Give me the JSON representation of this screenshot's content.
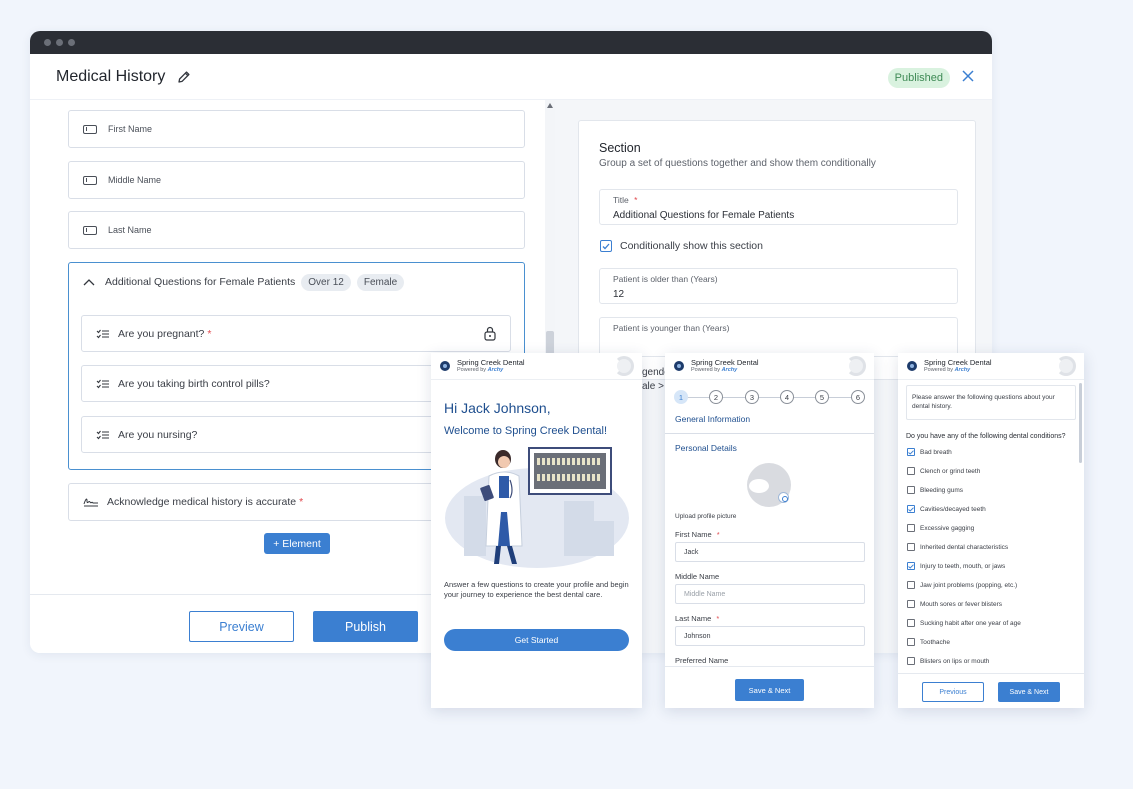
{
  "window": {
    "title": "Medical History",
    "status_badge": "Published"
  },
  "form": {
    "fields": [
      {
        "label": "First Name"
      },
      {
        "label": "Middle Name"
      },
      {
        "label": "Last Name"
      }
    ],
    "section": {
      "title": "Additional Questions for Female Patients",
      "tags": [
        "Over 12",
        "Female"
      ],
      "questions": [
        {
          "label": "Are you pregnant?",
          "required_mark": "*"
        },
        {
          "label": "Are you taking birth control pills?"
        },
        {
          "label": "Are you nursing?"
        }
      ]
    },
    "acknowledge": {
      "label": "Acknowledge medical history is accurate",
      "required_mark": "*"
    },
    "add_element_label": "+ Element",
    "preview_label": "Preview",
    "publish_label": "Publish"
  },
  "config": {
    "heading": "Section",
    "subheading": "Group a set of questions together and show them conditionally",
    "title_label": "Title",
    "title_required": "*",
    "title_value": "Additional Questions for Female Patients",
    "conditional_label": "Conditionally show this section",
    "conditional_checked": true,
    "older_label": "Patient is older than (Years)",
    "older_value": "12",
    "younger_label": "Patient is younger than (Years)",
    "peek_gender": "gende",
    "peek_select": "ale >"
  },
  "phone_common": {
    "brand": "Spring Creek Dental",
    "powered": "Powered by",
    "powered_brand": "Archy"
  },
  "phone1": {
    "greeting": "Hi Jack Johnson,",
    "welcome": "Welcome to Spring Creek Dental!",
    "description": "Answer a few questions to create your profile and begin your journey to experience the best dental care.",
    "cta": "Get Started"
  },
  "phone2": {
    "steps": [
      "1",
      "2",
      "3",
      "4",
      "5",
      "6"
    ],
    "heading": "General Information",
    "subheading": "Personal Details",
    "upload_label": "Upload profile picture",
    "first_name_label": "First Name",
    "first_name_value": "Jack",
    "middle_name_label": "Middle Name",
    "middle_name_placeholder": "Middle Name",
    "last_name_label": "Last Name",
    "last_name_value": "Johnson",
    "preferred_label": "Preferred Name",
    "save_next": "Save & Next",
    "required_mark": "*"
  },
  "phone3": {
    "intro": "Please answer the following questions about your dental history.",
    "question": "Do you have any of the following dental conditions?",
    "options": [
      {
        "label": "Bad breath",
        "checked": true
      },
      {
        "label": "Clench or grind teeth",
        "checked": false
      },
      {
        "label": "Bleeding gums",
        "checked": false
      },
      {
        "label": "Cavities/decayed teeth",
        "checked": true
      },
      {
        "label": "Excessive gagging",
        "checked": false
      },
      {
        "label": "Inherited dental characteristics",
        "checked": false
      },
      {
        "label": "Injury to teeth, mouth, or jaws",
        "checked": true
      },
      {
        "label": "Jaw joint problems (popping, etc.)",
        "checked": false
      },
      {
        "label": "Mouth sores or fever blisters",
        "checked": false
      },
      {
        "label": "Sucking habit after one year of age",
        "checked": false
      },
      {
        "label": "Toothache",
        "checked": false
      },
      {
        "label": "Blisters on lips or mouth",
        "checked": false
      }
    ],
    "previous": "Previous",
    "save_next": "Save & Next"
  },
  "colors": {
    "accent": "#3b7fd1",
    "heading_blue": "#1f4f8f",
    "published_bg": "#d9f2df",
    "required": "#e0474c"
  }
}
